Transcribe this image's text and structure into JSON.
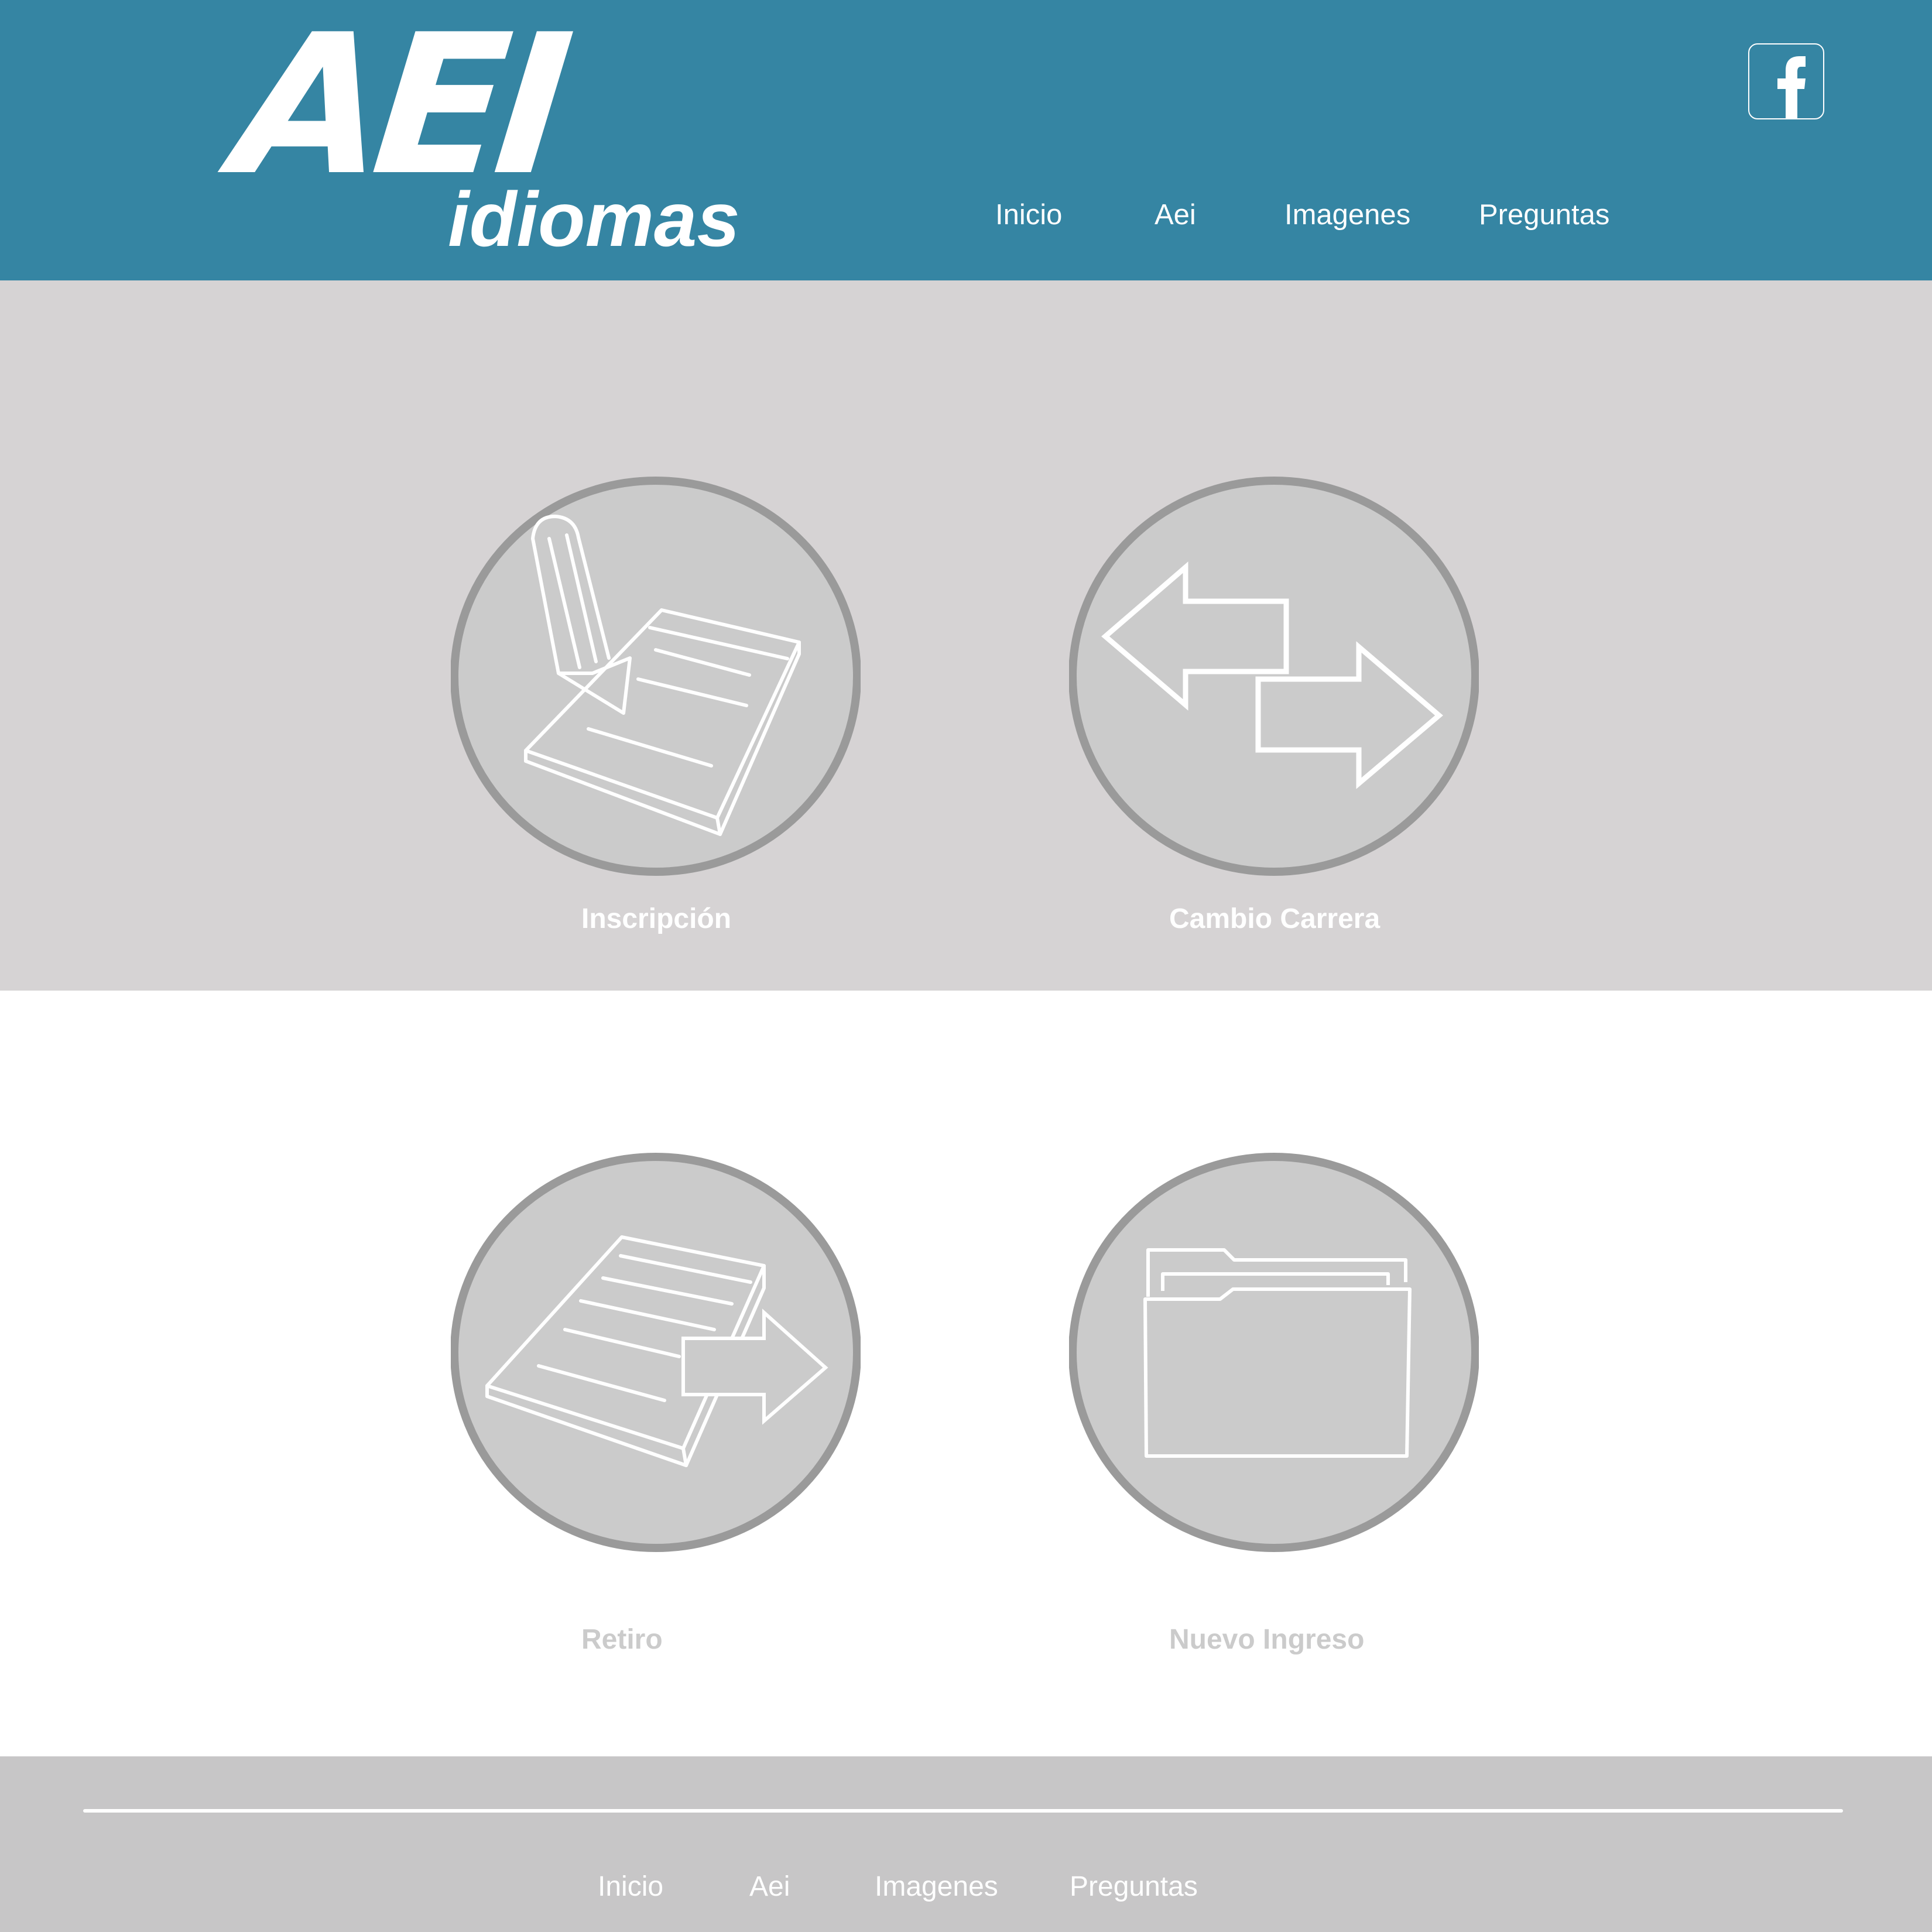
{
  "header": {
    "logo": {
      "mark": "AEI",
      "wordmark": "idiomas"
    },
    "facebook_icon": "facebook-icon",
    "nav": [
      "Inicio",
      "Aei",
      "Imagenes",
      "Preguntas"
    ]
  },
  "options": [
    {
      "label": "Inscripción",
      "icon": "notepad-pencil-icon"
    },
    {
      "label": "Cambio Carrera",
      "icon": "swap-arrows-icon"
    },
    {
      "label": "Retiro",
      "icon": "notepad-arrow-icon"
    },
    {
      "label": "Nuevo Ingreso",
      "icon": "folder-icon"
    }
  ],
  "footer": {
    "nav": [
      "Inicio",
      "Aei",
      "Imagenes",
      "Preguntas"
    ]
  },
  "colors": {
    "header": "#3585a3",
    "top_band": "#d6d3d4",
    "footer": "#c7c6c7",
    "circle_fill": "#cbcbcb",
    "circle_stroke": "#9a9a9a",
    "muted_label": "#cbcbcb"
  }
}
